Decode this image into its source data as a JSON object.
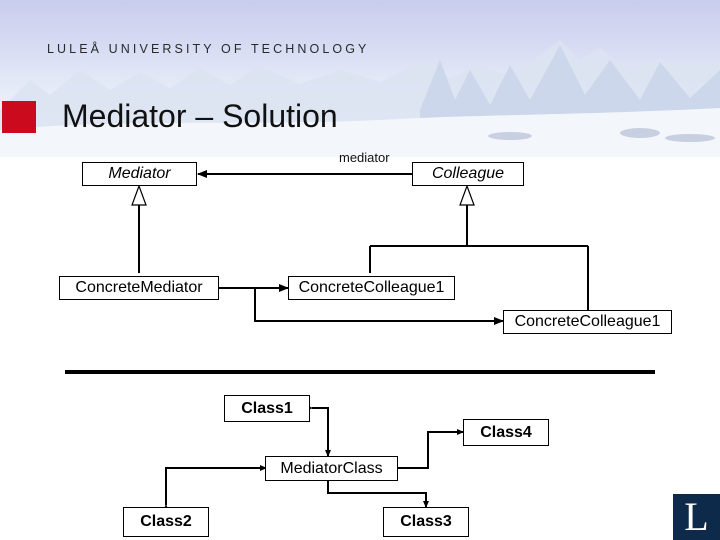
{
  "header": {
    "university": "LULEÅ UNIVERSITY OF TECHNOLOGY",
    "title": "Mediator – Solution",
    "accent_color": "#cc0a1e"
  },
  "structure_diagram": {
    "classes": {
      "mediator": "Mediator",
      "colleague": "Colleague",
      "concrete_mediator": "ConcreteMediator",
      "concrete_colleague_a": "ConcreteColleague1",
      "concrete_colleague_b": "ConcreteColleague1"
    },
    "association_label": "mediator",
    "relations": [
      {
        "from": "Colleague",
        "to": "Mediator",
        "type": "association",
        "label": "mediator"
      },
      {
        "from": "ConcreteMediator",
        "to": "Mediator",
        "type": "generalization"
      },
      {
        "from": "ConcreteColleague1",
        "to": "Colleague",
        "type": "generalization"
      },
      {
        "from": "ConcreteMediator",
        "to": "ConcreteColleague1",
        "type": "association"
      },
      {
        "from": "ConcreteMediator",
        "to": "ConcreteColleague1 (2)",
        "type": "association"
      }
    ]
  },
  "example_diagram": {
    "classes": {
      "class1": "Class1",
      "class2": "Class2",
      "class3": "Class3",
      "class4": "Class4",
      "mediator_class": "MediatorClass"
    },
    "relations": [
      {
        "between": [
          "MediatorClass",
          "Class1"
        ],
        "type": "bidirectional"
      },
      {
        "between": [
          "MediatorClass",
          "Class2"
        ],
        "type": "bidirectional"
      },
      {
        "between": [
          "MediatorClass",
          "Class3"
        ],
        "type": "bidirectional"
      },
      {
        "between": [
          "MediatorClass",
          "Class4"
        ],
        "type": "bidirectional"
      }
    ]
  },
  "logo": {
    "letter": "L",
    "color": "#0d2a4a"
  }
}
